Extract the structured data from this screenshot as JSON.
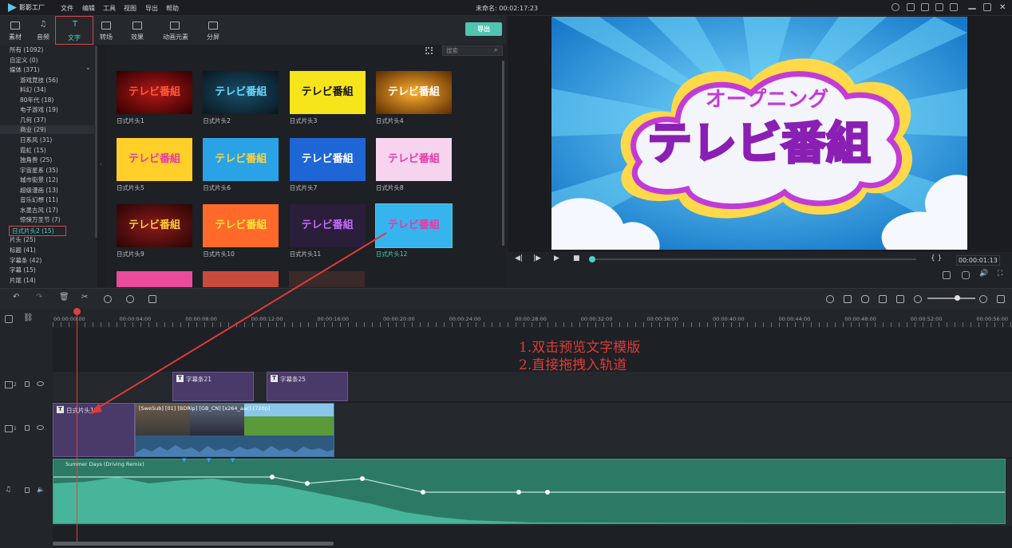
{
  "app": {
    "name": "影影工厂",
    "menu": [
      "文件",
      "编辑",
      "工具",
      "视图",
      "导出",
      "帮助"
    ],
    "doc_title": "未命名: 00:02:17:23"
  },
  "toolbar": {
    "tabs": [
      {
        "label": "素材",
        "icon": "folder-icon"
      },
      {
        "label": "音频",
        "icon": "music-note-icon"
      },
      {
        "label": "文字",
        "icon": "text-icon"
      },
      {
        "label": "转场",
        "icon": "transition-icon"
      },
      {
        "label": "效果",
        "icon": "effects-icon"
      },
      {
        "label": "动画元素",
        "icon": "image-icon"
      },
      {
        "label": "分屏",
        "icon": "split-screen-icon"
      }
    ],
    "export_label": "导出"
  },
  "sidebar": {
    "items": [
      {
        "label": "所有 (1092)",
        "level": 0
      },
      {
        "label": "自定义 (0)",
        "level": 0
      },
      {
        "label": "媒体 (371)",
        "level": 0
      },
      {
        "label": "游戏竞技 (56)",
        "level": 1
      },
      {
        "label": "料幻 (34)",
        "level": 1
      },
      {
        "label": "80年代 (18)",
        "level": 1
      },
      {
        "label": "电子游戏 (19)",
        "level": 1
      },
      {
        "label": "几何 (37)",
        "level": 1
      },
      {
        "label": "商业 (29)",
        "level": 1
      },
      {
        "label": "日系风 (31)",
        "level": 1
      },
      {
        "label": "霓虹 (15)",
        "level": 1
      },
      {
        "label": "独角兽 (25)",
        "level": 1
      },
      {
        "label": "宇宙星系 (35)",
        "level": 1
      },
      {
        "label": "城市街景 (12)",
        "level": 1
      },
      {
        "label": "超级漫画 (13)",
        "level": 1
      },
      {
        "label": "音乐幻想 (11)",
        "level": 1
      },
      {
        "label": "水墨古风 (17)",
        "level": 1
      },
      {
        "label": "惊悚万圣节 (7)",
        "level": 1
      },
      {
        "label": "日式片头2 (15)",
        "level": 1
      },
      {
        "label": "片头 (25)",
        "level": 0
      },
      {
        "label": "标题 (41)",
        "level": 0
      },
      {
        "label": "字幕条 (42)",
        "level": 0
      },
      {
        "label": "字幕 (15)",
        "level": 0
      },
      {
        "label": "片尾 (14)",
        "level": 0
      }
    ]
  },
  "search": {
    "placeholder": "搜索"
  },
  "templates": [
    {
      "label": "日式片头1",
      "title": "テレビ番組"
    },
    {
      "label": "日式片头2",
      "title": "テレビ番組"
    },
    {
      "label": "日式片头3",
      "title": "テレビ番組"
    },
    {
      "label": "日式片头4",
      "title": "テレビ番組"
    },
    {
      "label": "日式片头5",
      "title": "テレビ番組"
    },
    {
      "label": "日式片头6",
      "title": "テレビ番組"
    },
    {
      "label": "日式片头7",
      "title": "テレビ番組"
    },
    {
      "label": "日式片头8",
      "title": "テレビ番組"
    },
    {
      "label": "日式片头9",
      "title": "テレビ番組"
    },
    {
      "label": "日式片头10",
      "title": "テレビ番組"
    },
    {
      "label": "日式片头11",
      "title": "テレビ番組"
    },
    {
      "label": "日式片头12",
      "title": "テレビ番組"
    }
  ],
  "preview": {
    "subtitle": "オープニング",
    "title": "テレビ番組",
    "timecode": "00:00:01:13"
  },
  "ruler": [
    "00:00:00:00",
    "00:00:04:00",
    "00:00:08:00",
    "00:00:12:00",
    "00:00:16:00",
    "00:00:20:00",
    "00:00:24:00",
    "00:00:28:00",
    "00:00:32:00",
    "00:00:36:00",
    "00:00:40:00",
    "00:00:44:00",
    "00:00:48:00",
    "00:00:52:00",
    "00:00:56:00"
  ],
  "tracks": {
    "t2_label": "2",
    "t1_label": "1",
    "clip_sub1": "字幕条21",
    "clip_sub2": "字幕条25",
    "clip_title": "日式片头12",
    "clip_video": "[SweSub] [01] [BDRip] [GB_CN] [x264_aac] [720p]",
    "clip_audio": "Summer Days (Driving Remix)"
  },
  "annotations": {
    "line1": "1.双击预览文字模版",
    "line2": "2.直接拖拽入轨道"
  },
  "colors": {
    "accent": "#4fd1c5",
    "highlight": "#d9454a",
    "audio": "#2c7a65"
  }
}
